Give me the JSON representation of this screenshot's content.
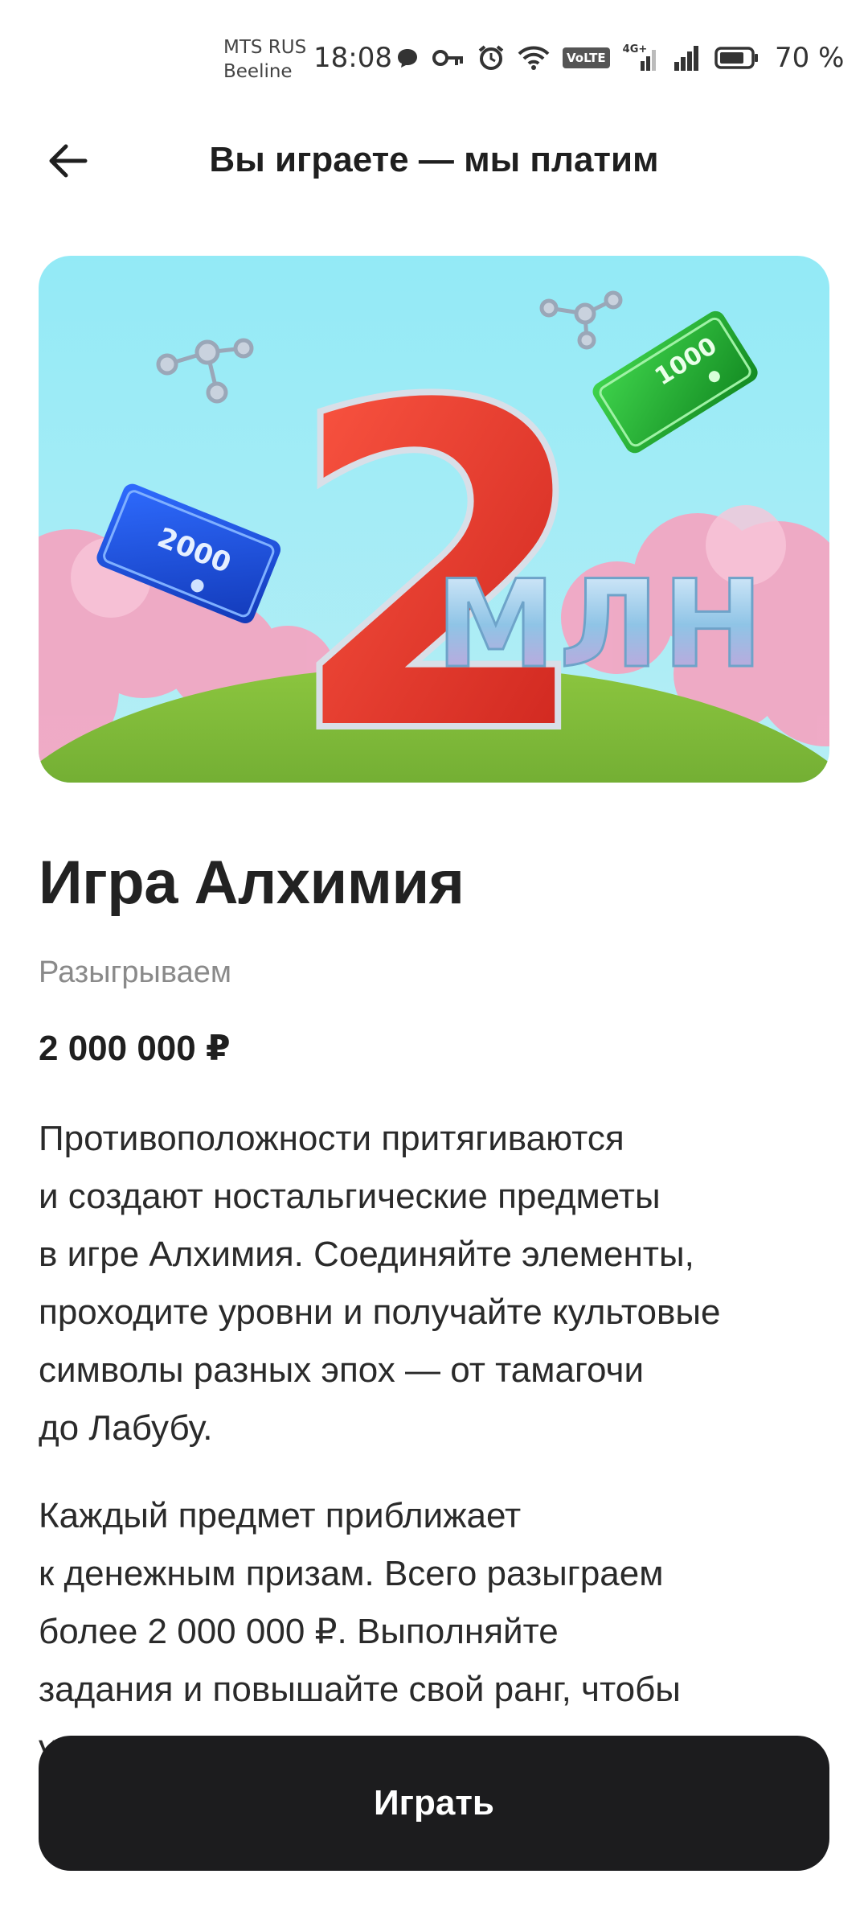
{
  "status_bar": {
    "carrier_1": "MTS RUS",
    "carrier_2": "Beeline",
    "time": "18:08",
    "volte": "VoLTE",
    "network": "4G+",
    "battery": "70 %"
  },
  "header": {
    "title": "Вы играете — мы платим"
  },
  "banner": {
    "big_number": "2",
    "unit_text": "МЛН",
    "banknote_blue": "2000",
    "banknote_green": "1000"
  },
  "game": {
    "title": "Игра Алхимия",
    "prize_label": "Разыгрываем",
    "prize_value": "2 000 000 ₽"
  },
  "description": {
    "paragraph_1": [
      "Противоположности притягиваются",
      "и создают ностальгические предметы",
      "в игре Алхимия. Соединяйте элементы,",
      "проходите уровни и получайте культовые",
      "символы разных эпох — от тамагочи",
      "до Лабубу."
    ],
    "paragraph_2": [
      "Каждый предмет приближает",
      "к денежным призам. Всего разыграем",
      "более 2 000 000 ₽. Выполняйте",
      "задания и повышайте свой ранг, чтобы",
      "у"
    ]
  },
  "play_button": {
    "label": "Играть"
  },
  "colors": {
    "button_bg": "#1c1c1e",
    "banner_sky": "#8fe6f3",
    "number_red": "#e5352b",
    "grass": "#6aa82a",
    "cloud_pink": "#f2a7c3"
  },
  "icons": [
    "back-arrow-icon",
    "message-icon",
    "key-icon",
    "alarm-icon",
    "wifi-icon",
    "signal-icon",
    "battery-icon"
  ]
}
